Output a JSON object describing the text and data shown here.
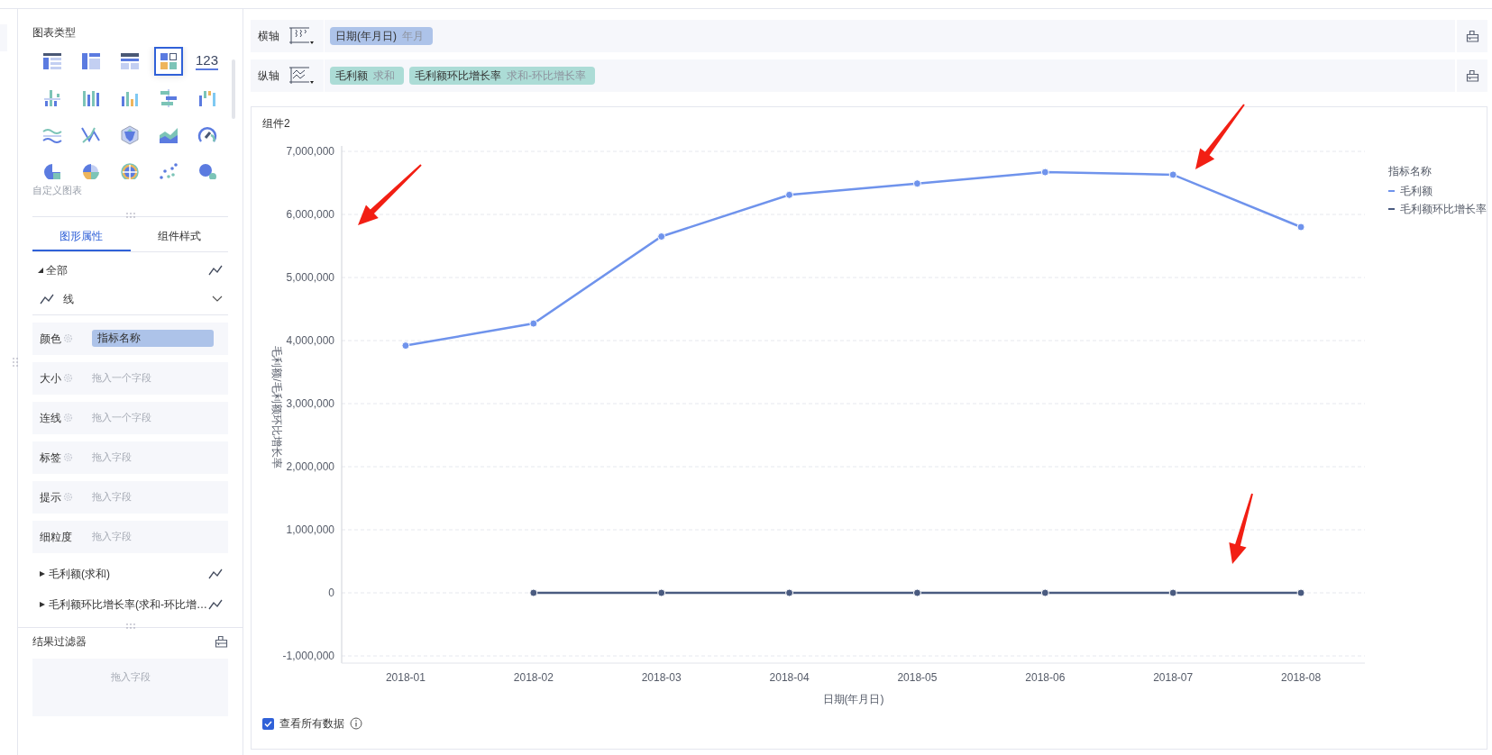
{
  "chart_types": {
    "title": "图表类型",
    "items": [
      {
        "kind": "detail-table",
        "selected": false
      },
      {
        "kind": "cross-table",
        "selected": false
      },
      {
        "kind": "group-table",
        "selected": false
      },
      {
        "kind": "combo",
        "selected": true
      },
      {
        "kind": "number",
        "label": "123",
        "selected": false
      },
      {
        "kind": "dot-bar",
        "selected": false
      },
      {
        "kind": "multi-bar",
        "selected": false
      },
      {
        "kind": "bar",
        "selected": false
      },
      {
        "kind": "range-bar",
        "selected": false
      },
      {
        "kind": "waterfall",
        "selected": false
      },
      {
        "kind": "stream",
        "selected": false
      },
      {
        "kind": "cross-line",
        "selected": false
      },
      {
        "kind": "radar",
        "selected": false
      },
      {
        "kind": "area",
        "selected": false
      },
      {
        "kind": "gauge",
        "selected": false
      },
      {
        "kind": "pie",
        "selected": false
      },
      {
        "kind": "rose",
        "selected": false
      },
      {
        "kind": "sunburst",
        "selected": false
      },
      {
        "kind": "scatter",
        "selected": false
      },
      {
        "kind": "bubble",
        "selected": false
      }
    ],
    "custom_label": "自定义图表"
  },
  "tabs": [
    {
      "label": "图形属性",
      "selected": true
    },
    {
      "label": "组件样式",
      "selected": false
    }
  ],
  "marks": {
    "all": {
      "label": "全部",
      "expanded": true
    },
    "mark_type": "线",
    "fields": [
      {
        "label": "颜色",
        "settings": true,
        "value": "指标名称"
      },
      {
        "label": "大小",
        "settings": true,
        "placeholder": "拖入一个字段"
      },
      {
        "label": "连线",
        "settings": true,
        "placeholder": "拖入一个字段"
      },
      {
        "label": "标签",
        "settings": true,
        "placeholder": "拖入字段"
      },
      {
        "label": "提示",
        "settings": true,
        "placeholder": "拖入字段"
      },
      {
        "label": "细粒度",
        "settings": false,
        "placeholder": "拖入字段"
      }
    ],
    "series": [
      {
        "label": "毛利额(求和)",
        "expanded": false
      },
      {
        "label": "毛利额环比增长率(求和-环比增…",
        "expanded": false
      }
    ]
  },
  "result_filter": {
    "title": "结果过滤器",
    "placeholder": "拖入字段"
  },
  "axes": [
    {
      "label": "横轴",
      "kind": "x",
      "pills": [
        {
          "name": "日期(年月日)",
          "detail": "年月",
          "kind": "dimension"
        }
      ]
    },
    {
      "label": "纵轴",
      "kind": "y",
      "pills": [
        {
          "name": "毛利额",
          "detail": "求和",
          "kind": "measure"
        },
        {
          "name": "毛利额环比增长率",
          "detail": "求和-环比增长率",
          "kind": "measure"
        }
      ]
    }
  ],
  "component": {
    "title": "组件2",
    "chart_data": {
      "type": "line",
      "xlabel": "日期(年月日)",
      "ylabel": "毛利额/毛利额环比增长率",
      "categories": [
        "2018-01",
        "2018-02",
        "2018-03",
        "2018-04",
        "2018-05",
        "2018-06",
        "2018-07",
        "2018-08"
      ],
      "series": [
        {
          "name": "毛利额",
          "color": "#6f93ec",
          "marker": true,
          "values": [
            3920000,
            4270000,
            5650000,
            6310000,
            6490000,
            6670000,
            6630000,
            5800000
          ]
        },
        {
          "name": "毛利额环比增长率",
          "color": "#4a5b80",
          "marker": true,
          "values": [
            null,
            0,
            0,
            0,
            0,
            0,
            0,
            0
          ]
        }
      ],
      "ylim": [
        -1000000,
        7000000
      ],
      "grid": true,
      "yticks": [
        {
          "value": -1000000,
          "label": "-1,000,000"
        },
        {
          "value": 0,
          "label": "0"
        },
        {
          "value": 1000000,
          "label": "1,000,000"
        },
        {
          "value": 2000000,
          "label": "2,000,000"
        },
        {
          "value": 3000000,
          "label": "3,000,000"
        },
        {
          "value": 4000000,
          "label": "4,000,000"
        },
        {
          "value": 5000000,
          "label": "5,000,000"
        },
        {
          "value": 6000000,
          "label": "6,000,000"
        },
        {
          "value": 7000000,
          "label": "7,000,000"
        }
      ]
    },
    "legend_title": "指标名称",
    "view_all": {
      "label": "查看所有数据",
      "checked": true
    }
  }
}
